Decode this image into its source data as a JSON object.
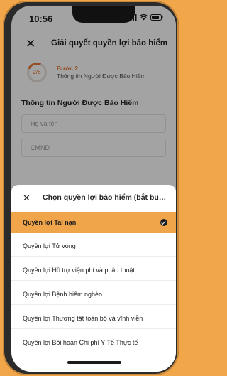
{
  "status_bar": {
    "time": "10:56",
    "icons": [
      "signal-icon",
      "wifi-icon",
      "battery-icon"
    ]
  },
  "header": {
    "close_icon": "close-icon",
    "title": "Giải quyết quyền lợi bảo hiểm"
  },
  "step": {
    "progress": "2/6",
    "label": "Bước 2",
    "description": "Thông tin Người Được Bảo Hiểm"
  },
  "form": {
    "section_title": "Thông tin Người Được Bảo Hiểm",
    "fields": [
      {
        "placeholder": "Họ và tên"
      },
      {
        "placeholder": "CMND"
      }
    ]
  },
  "sheet": {
    "close_icon": "close-icon",
    "title": "Chọn quyền lợi bảo hiểm (bắt buộc)",
    "options": [
      {
        "label": "Quyền lợi Tai nạn",
        "selected": true
      },
      {
        "label": "Quyền lợi Tử vong",
        "selected": false
      },
      {
        "label": "Quyền lợi Hỗ trợ viện phí và phẫu thuật",
        "selected": false
      },
      {
        "label": "Quyền lợi Bệnh hiểm nghèo",
        "selected": false
      },
      {
        "label": "Quyền lợi Thương tật toàn bộ và vĩnh viễn",
        "selected": false
      },
      {
        "label": "Quyền lợi Bồi hoàn Chi phí Y Tế Thực tế",
        "selected": false
      }
    ]
  },
  "colors": {
    "accent": "#f0a54a",
    "step_accent": "#e87a3a",
    "background": "#f2a64a"
  }
}
